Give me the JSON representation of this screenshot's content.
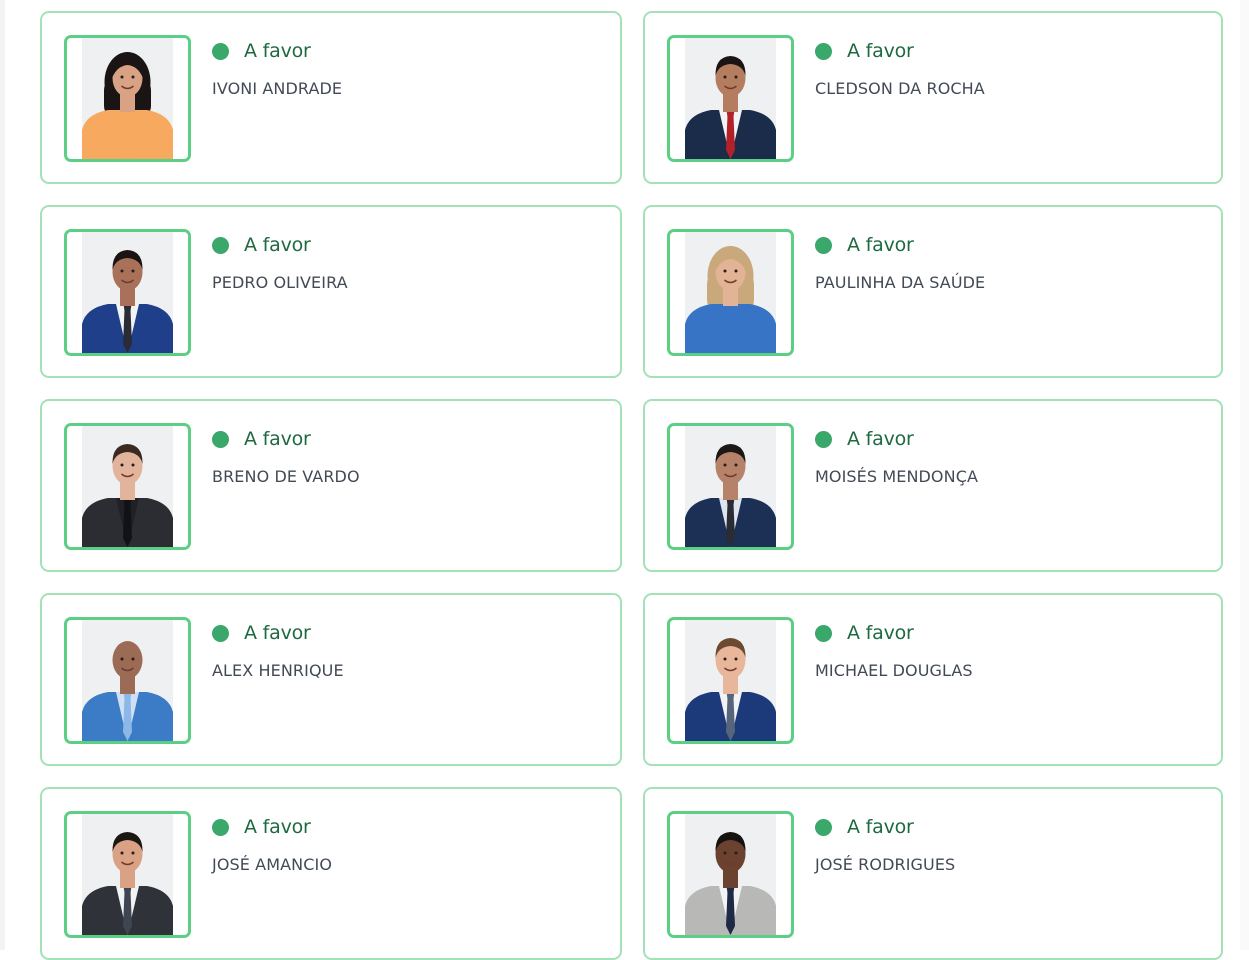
{
  "colors": {
    "card_border": "#a3e2b7",
    "photo_border": "#5ccf85",
    "status_dot": "#3aa86a",
    "status_text": "#1e6a40",
    "name_text": "#424a55"
  },
  "icons": {
    "status": "status-dot-icon"
  },
  "members": [
    {
      "status": "A favor",
      "name": "IVONI ANDRADE",
      "photo": {
        "skin": "#d9a285",
        "hair": "#1b1414",
        "top": "#f6a95f",
        "shirt": "#f6a95f",
        "tie": "#f6a95f",
        "tieOn": false,
        "longHair": true,
        "bald": false
      }
    },
    {
      "status": "A favor",
      "name": "CLEDSON DA ROCHA",
      "photo": {
        "skin": "#b57d5f",
        "hair": "#1a1512",
        "top": "#1b2b4a",
        "shirt": "#f1f3f5",
        "tie": "#b3202a",
        "tieOn": true,
        "longHair": false,
        "bald": false
      }
    },
    {
      "status": "A favor",
      "name": "PEDRO OLIVEIRA",
      "photo": {
        "skin": "#a9715a",
        "hair": "#1a1512",
        "top": "#1f3f8a",
        "shirt": "#f1f3f5",
        "tie": "#2a2c35",
        "tieOn": true,
        "longHair": false,
        "bald": false
      }
    },
    {
      "status": "A favor",
      "name": "PAULINHA DA SAÚDE",
      "photo": {
        "skin": "#e3b395",
        "hair": "#c9a97c",
        "top": "#3874c6",
        "shirt": "#3874c6",
        "tie": "#3874c6",
        "tieOn": false,
        "longHair": true,
        "bald": false
      }
    },
    {
      "status": "A favor",
      "name": "BRENO DE VARDO",
      "photo": {
        "skin": "#e2b49b",
        "hair": "#3a2a20",
        "top": "#2b2d33",
        "shirt": "#1f2126",
        "tie": "#111216",
        "tieOn": true,
        "longHair": false,
        "bald": false
      }
    },
    {
      "status": "A favor",
      "name": "MOISÉS MENDONÇA",
      "photo": {
        "skin": "#b6826a",
        "hair": "#1c1816",
        "top": "#1c2f55",
        "shirt": "#dfe5ee",
        "tie": "#2a2c35",
        "tieOn": true,
        "longHair": false,
        "bald": false
      }
    },
    {
      "status": "A favor",
      "name": "ALEX HENRIQUE",
      "photo": {
        "skin": "#9c6b55",
        "hair": "#9c6b55",
        "top": "#3c7cc6",
        "shirt": "#cfe0f5",
        "tie": "#8cb8e8",
        "tieOn": true,
        "longHair": false,
        "bald": true
      }
    },
    {
      "status": "A favor",
      "name": "MICHAEL DOUGLAS",
      "photo": {
        "skin": "#e8b69b",
        "hair": "#6b4a30",
        "top": "#1c3a7a",
        "shirt": "#f1f3f5",
        "tie": "#56657c",
        "tieOn": true,
        "longHair": false,
        "bald": false
      }
    },
    {
      "status": "A favor",
      "name": "JOSÉ AMANCIO",
      "photo": {
        "skin": "#d9a285",
        "hair": "#1c1713",
        "top": "#2f3238",
        "shirt": "#f1f3f5",
        "tie": "#404552",
        "tieOn": true,
        "longHair": false,
        "bald": false
      }
    },
    {
      "status": "A favor",
      "name": "JOSÉ RODRIGUES",
      "photo": {
        "skin": "#6b4230",
        "hair": "#151210",
        "top": "#b8b8b6",
        "shirt": "#f1f3f5",
        "tie": "#1f2a45",
        "tieOn": true,
        "longHair": false,
        "bald": false
      }
    }
  ]
}
